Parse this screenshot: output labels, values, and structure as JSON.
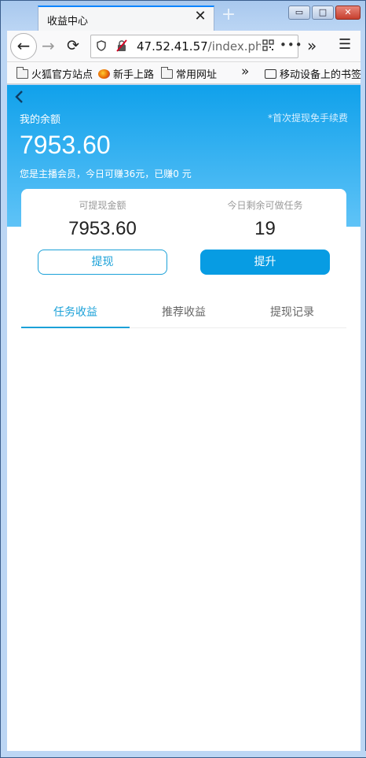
{
  "browser": {
    "tab_title": "收益中心",
    "tab_close": "✕",
    "new_tab": "+",
    "window_buttons": {
      "minimize": "▭",
      "maximize": "□",
      "close": "✕"
    },
    "nav": {
      "back": "←",
      "forward": "→",
      "reload": "⟳"
    },
    "url": {
      "host": "47.52.41.57",
      "path": "/index.php/"
    },
    "url_more": "•••",
    "overflow_chevron": "»",
    "menu": "☰",
    "bookmarks": [
      {
        "label": "火狐官方站点",
        "icon": "folder-icon"
      },
      {
        "label": "新手上路",
        "icon": "firefox-icon"
      },
      {
        "label": "常用网址",
        "icon": "folder-icon"
      },
      {
        "label": "移动设备上的书签",
        "icon": "mobile-icon"
      }
    ],
    "bookmarks_chevron": "»"
  },
  "wallet": {
    "back_icon": "‹",
    "title": "我的余额",
    "note": "*首次提现免手续费",
    "balance": "7953.60",
    "member_info": "您是主播会员，今日可赚36元，已赚0 元"
  },
  "card": {
    "withdrawable_label": "可提现金额",
    "withdrawable_value": "7953.60",
    "tasks_label": "今日剩余可做任务",
    "tasks_value": "19",
    "withdraw_button": "提现",
    "upgrade_button": "提升"
  },
  "tabs": [
    {
      "label": "任务收益",
      "active": true
    },
    {
      "label": "推荐收益",
      "active": false
    },
    {
      "label": "提现记录",
      "active": false
    }
  ],
  "colors": {
    "accent": "#1ba1d8",
    "hero_top": "#10a1eb",
    "hero_bottom": "#5fc3f7",
    "button_primary": "#079ce3"
  }
}
